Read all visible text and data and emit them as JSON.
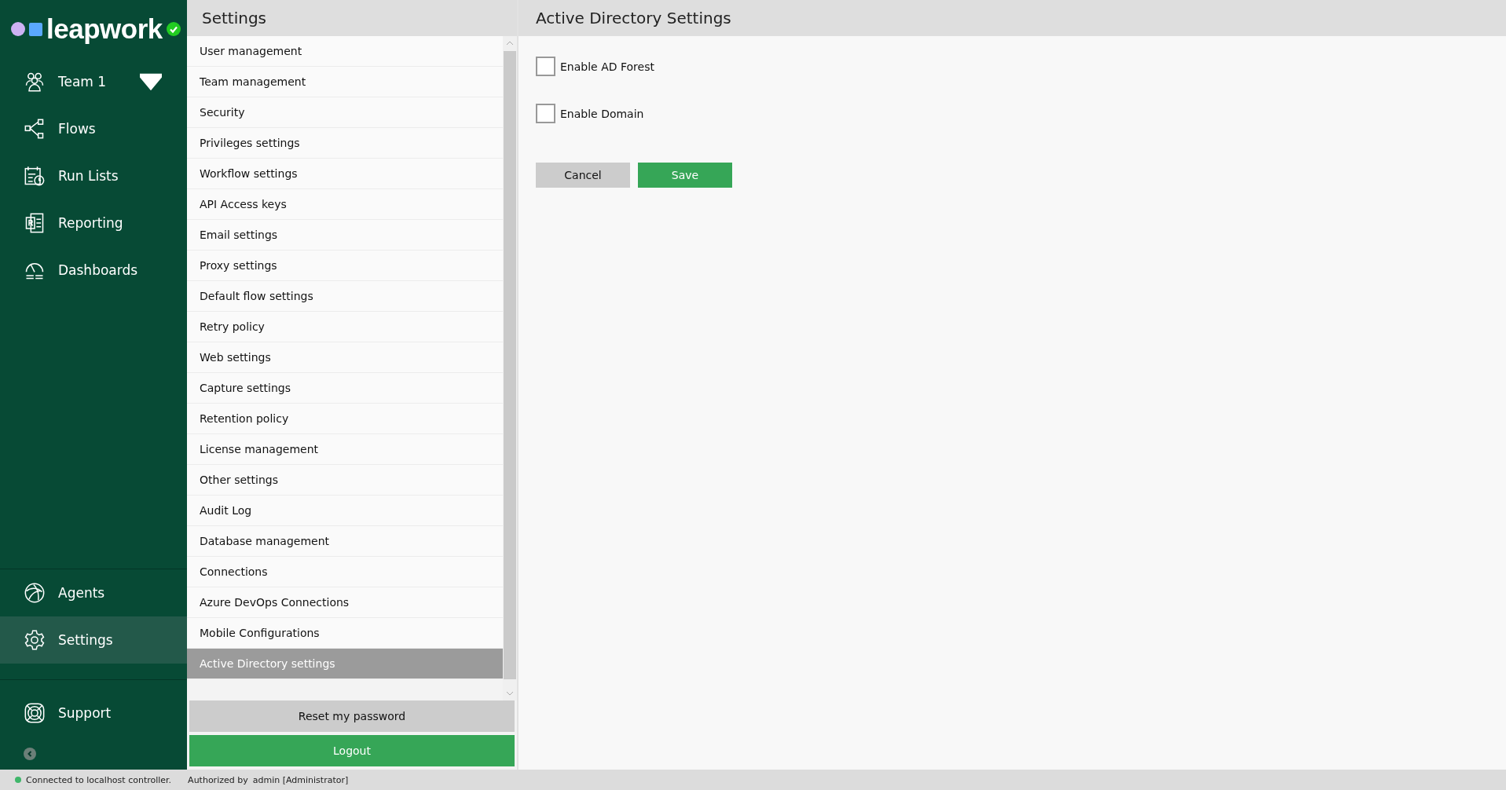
{
  "brand": {
    "name": "leapwork"
  },
  "nav": {
    "team": {
      "label": "Team 1"
    },
    "items": [
      {
        "kind": "flows",
        "label": "Flows",
        "selected": false
      },
      {
        "kind": "runlists",
        "label": "Run Lists",
        "selected": false
      },
      {
        "kind": "reporting",
        "label": "Reporting",
        "selected": false
      },
      {
        "kind": "dashboards",
        "label": "Dashboards",
        "selected": false
      }
    ],
    "bottom_items": [
      {
        "kind": "agents",
        "label": "Agents",
        "selected": false
      },
      {
        "kind": "settings",
        "label": "Settings",
        "selected": true
      }
    ],
    "support": {
      "label": "Support"
    }
  },
  "settings_menu": {
    "title": "Settings",
    "items": [
      {
        "label": "User management",
        "selected": false
      },
      {
        "label": "Team management",
        "selected": false
      },
      {
        "label": "Security",
        "selected": false
      },
      {
        "label": "Privileges settings",
        "selected": false
      },
      {
        "label": "Workflow settings",
        "selected": false
      },
      {
        "label": "API Access keys",
        "selected": false
      },
      {
        "label": "Email settings",
        "selected": false
      },
      {
        "label": "Proxy settings",
        "selected": false
      },
      {
        "label": "Default flow settings",
        "selected": false
      },
      {
        "label": "Retry policy",
        "selected": false
      },
      {
        "label": "Web settings",
        "selected": false
      },
      {
        "label": "Capture settings",
        "selected": false
      },
      {
        "label": "Retention policy",
        "selected": false
      },
      {
        "label": "License management",
        "selected": false
      },
      {
        "label": "Other settings",
        "selected": false
      },
      {
        "label": "Audit Log",
        "selected": false
      },
      {
        "label": "Database management",
        "selected": false
      },
      {
        "label": "Connections",
        "selected": false
      },
      {
        "label": "Azure DevOps Connections",
        "selected": false
      },
      {
        "label": "Mobile Configurations",
        "selected": false
      },
      {
        "label": "Active Directory settings",
        "selected": true
      }
    ],
    "buttons": [
      {
        "kind": "secondary",
        "label": "Reset my password"
      },
      {
        "kind": "primary",
        "label": "Logout"
      }
    ]
  },
  "content": {
    "title": "Active Directory Settings",
    "options": [
      {
        "label": "Enable AD Forest",
        "checked": false
      },
      {
        "label": "Enable Domain",
        "checked": false
      }
    ],
    "buttons": [
      {
        "kind": "secondary",
        "label": "Cancel"
      },
      {
        "kind": "primary",
        "label": "Save"
      }
    ]
  },
  "status_bar": {
    "connection": "Connected to localhost controller.",
    "connected": true,
    "auth_label": "Authorized by",
    "auth_user": "admin [Administrator]"
  }
}
